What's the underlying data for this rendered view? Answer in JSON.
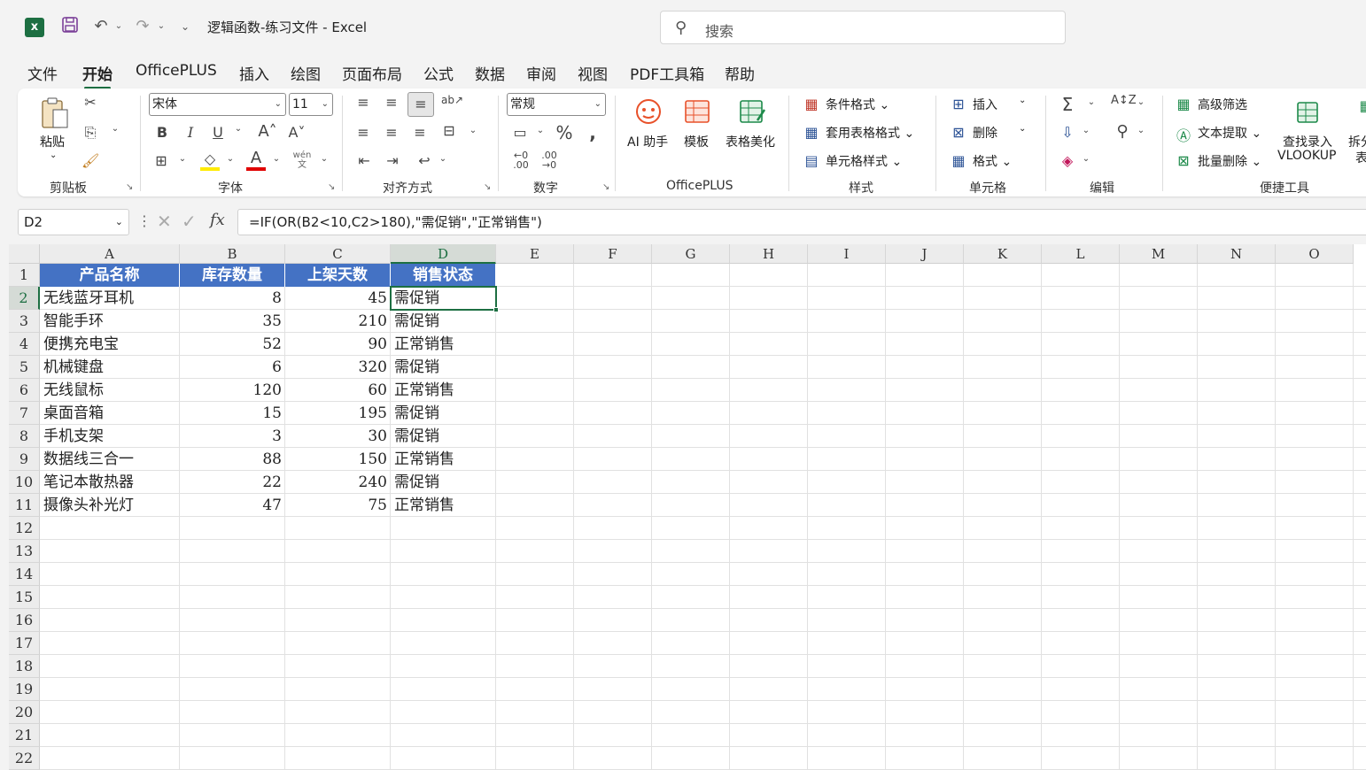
{
  "titlebar": {
    "logo": "x",
    "doc_title": "逻辑函数-练习文件  -  Excel",
    "search_placeholder": "搜索"
  },
  "tabs": [
    "文件",
    "开始",
    "OfficePLUS",
    "插入",
    "绘图",
    "页面布局",
    "公式",
    "数据",
    "审阅",
    "视图",
    "PDF工具箱",
    "帮助"
  ],
  "ribbon": {
    "clipboard": {
      "paste": "粘贴",
      "label": "剪贴板"
    },
    "font": {
      "name": "宋体",
      "size": "11",
      "label": "字体"
    },
    "alignment": {
      "label": "对齐方式"
    },
    "number": {
      "format": "常规",
      "label": "数字"
    },
    "officeplus": {
      "ai": "AI 助手",
      "template": "模板",
      "beautify": "表格美化",
      "label": "OfficePLUS"
    },
    "styles": {
      "conditional": "条件格式",
      "table_format": "套用表格格式",
      "cell_styles": "单元格样式",
      "label": "样式"
    },
    "cells": {
      "insert": "插入",
      "delete": "删除",
      "format": "格式",
      "label": "单元格"
    },
    "editing": {
      "label": "编辑"
    },
    "quick_tools": {
      "advanced_filter": "高级筛选",
      "text_extract": "文本提取",
      "batch_delete": "批量删除",
      "lookup_line1": "查找录入",
      "lookup_line2": "VLOOKUP",
      "split_line1": "拆分",
      "split_line2": "表",
      "label": "便捷工具"
    }
  },
  "formula_bar": {
    "name_box": "D2",
    "fx": "fx",
    "formula": "=IF(OR(B2<10,C2>180),\"需促销\",\"正常销售\")"
  },
  "sheet": {
    "columns": [
      "A",
      "B",
      "C",
      "D",
      "E",
      "F",
      "G",
      "H",
      "I",
      "J",
      "K",
      "L",
      "M",
      "N",
      "O"
    ],
    "rows": [
      "1",
      "2",
      "3",
      "4",
      "5",
      "6",
      "7",
      "8",
      "9",
      "10",
      "11",
      "12",
      "13",
      "14",
      "15",
      "16",
      "17",
      "18",
      "19",
      "20",
      "21",
      "22"
    ],
    "headers": [
      "产品名称",
      "库存数量",
      "上架天数",
      "销售状态"
    ],
    "data": [
      [
        "无线蓝牙耳机",
        "8",
        "45",
        "需促销"
      ],
      [
        "智能手环",
        "35",
        "210",
        "需促销"
      ],
      [
        "便携充电宝",
        "52",
        "90",
        "正常销售"
      ],
      [
        "机械键盘",
        "6",
        "320",
        "需促销"
      ],
      [
        "无线鼠标",
        "120",
        "60",
        "正常销售"
      ],
      [
        "桌面音箱",
        "15",
        "195",
        "需促销"
      ],
      [
        "手机支架",
        "3",
        "30",
        "需促销"
      ],
      [
        "数据线三合一",
        "88",
        "150",
        "正常销售"
      ],
      [
        "笔记本散热器",
        "22",
        "240",
        "需促销"
      ],
      [
        "摄像头补光灯",
        "47",
        "75",
        "正常销售"
      ]
    ],
    "selected_cell": "D2",
    "header_fill": "#4472c4",
    "accent": "#1d6f42"
  }
}
